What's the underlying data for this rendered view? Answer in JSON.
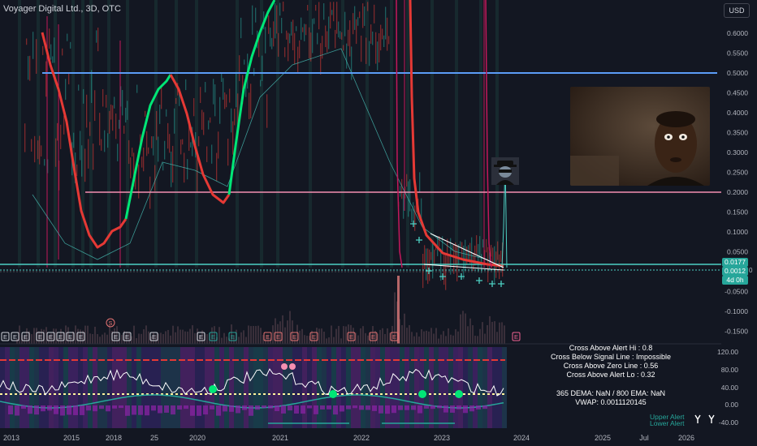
{
  "header": {
    "symbol_title": "Voyager Digital Ltd., 3D, OTC",
    "currency_button": "USD"
  },
  "price_axis": {
    "labels": [
      "0.6000",
      "0.5500",
      "0.5000",
      "0.4500",
      "0.4000",
      "0.3500",
      "0.3000",
      "0.2500",
      "0.2000",
      "0.1500",
      "0.1000",
      "0.0500",
      "-0.0500",
      "-0.1000",
      "-0.1500"
    ],
    "label_values": [
      0.6,
      0.55,
      0.5,
      0.45,
      0.4,
      0.35,
      0.3,
      0.25,
      0.2,
      0.15,
      0.1,
      0.05,
      -0.05,
      -0.1,
      -0.15
    ],
    "price_tag": "0.0177",
    "price_tag2": "0.0012",
    "countdown": "4d 0h",
    "partial_label": "0"
  },
  "indicator_axis": {
    "labels": [
      "120.00",
      "80.00",
      "40.00",
      "0.00",
      "-40.00"
    ]
  },
  "time_axis": {
    "labels": [
      "2013",
      "2015",
      "2018",
      "25",
      "2020",
      "2021",
      "2022",
      "2023",
      "2024",
      "2025",
      "Jul",
      "2026"
    ]
  },
  "info_box": {
    "lines_top": [
      "Cross Above Alert Hi : 0.8",
      "Cross Below Signal Line : Impossible",
      "Cross Above Zero Line : 0.56",
      "Cross Above Alert Lo : 0.32"
    ],
    "lines_bottom": [
      "365 DEMA: NaN  /  800 EMA: NaN",
      "VWAP: 0.0011120145"
    ]
  },
  "alert_legend": {
    "hi": "Upper Alert",
    "lo": "Lower Alert"
  },
  "event_markers": {
    "earnings_label": "E",
    "split_label": "S"
  },
  "colors": {
    "background": "#131722",
    "blue_line": "#5b9cf6",
    "pink_line": "#f48fb1",
    "teal_line": "#4dd0c4",
    "price_tag": "#26a69a",
    "red": "#e53935",
    "green": "#00e676"
  }
}
